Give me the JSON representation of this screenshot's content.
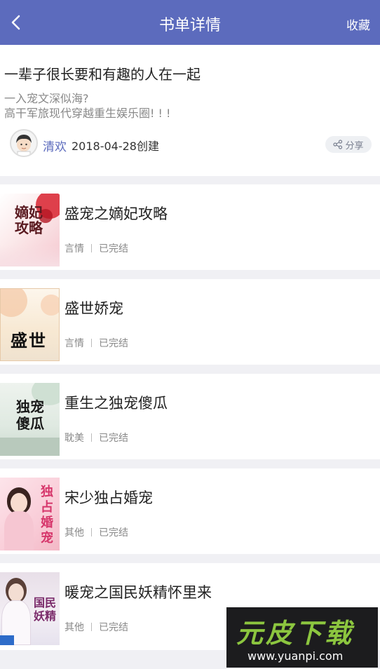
{
  "header": {
    "title": "书单详情",
    "favorite_label": "收藏"
  },
  "intro": {
    "title": "一辈子很长要和有趣的人在一起",
    "desc_line1": "一入宠文深似海?",
    "desc_line2": "高干军旅现代穿越重生娱乐圈! ! !",
    "author": "清欢",
    "created": "2018-04-28创建",
    "share_label": "分享"
  },
  "books": [
    {
      "title": "盛宠之嫡妃攻略",
      "category": "言情",
      "status": "已完结",
      "cover_text": "嫡妃攻略"
    },
    {
      "title": "盛世娇宠",
      "category": "言情",
      "status": "已完结",
      "cover_text": "盛世"
    },
    {
      "title": "重生之独宠傻瓜",
      "category": "耽美",
      "status": "已完结",
      "cover_text": "独宠傻瓜"
    },
    {
      "title": "宋少独占婚宠",
      "category": "其他",
      "status": "已完结",
      "cover_text": "独占婚宠"
    },
    {
      "title": "暖宠之国民妖精怀里来",
      "category": "其他",
      "status": "已完结",
      "cover_text": "国民妖精"
    }
  ],
  "watermark": {
    "brand": "元皮下载",
    "url": "www.yuanpi.com"
  },
  "colors": {
    "header_bg": "#5c6bbd",
    "author_link": "#5c6bbd",
    "page_bg": "#f0f0f4"
  }
}
